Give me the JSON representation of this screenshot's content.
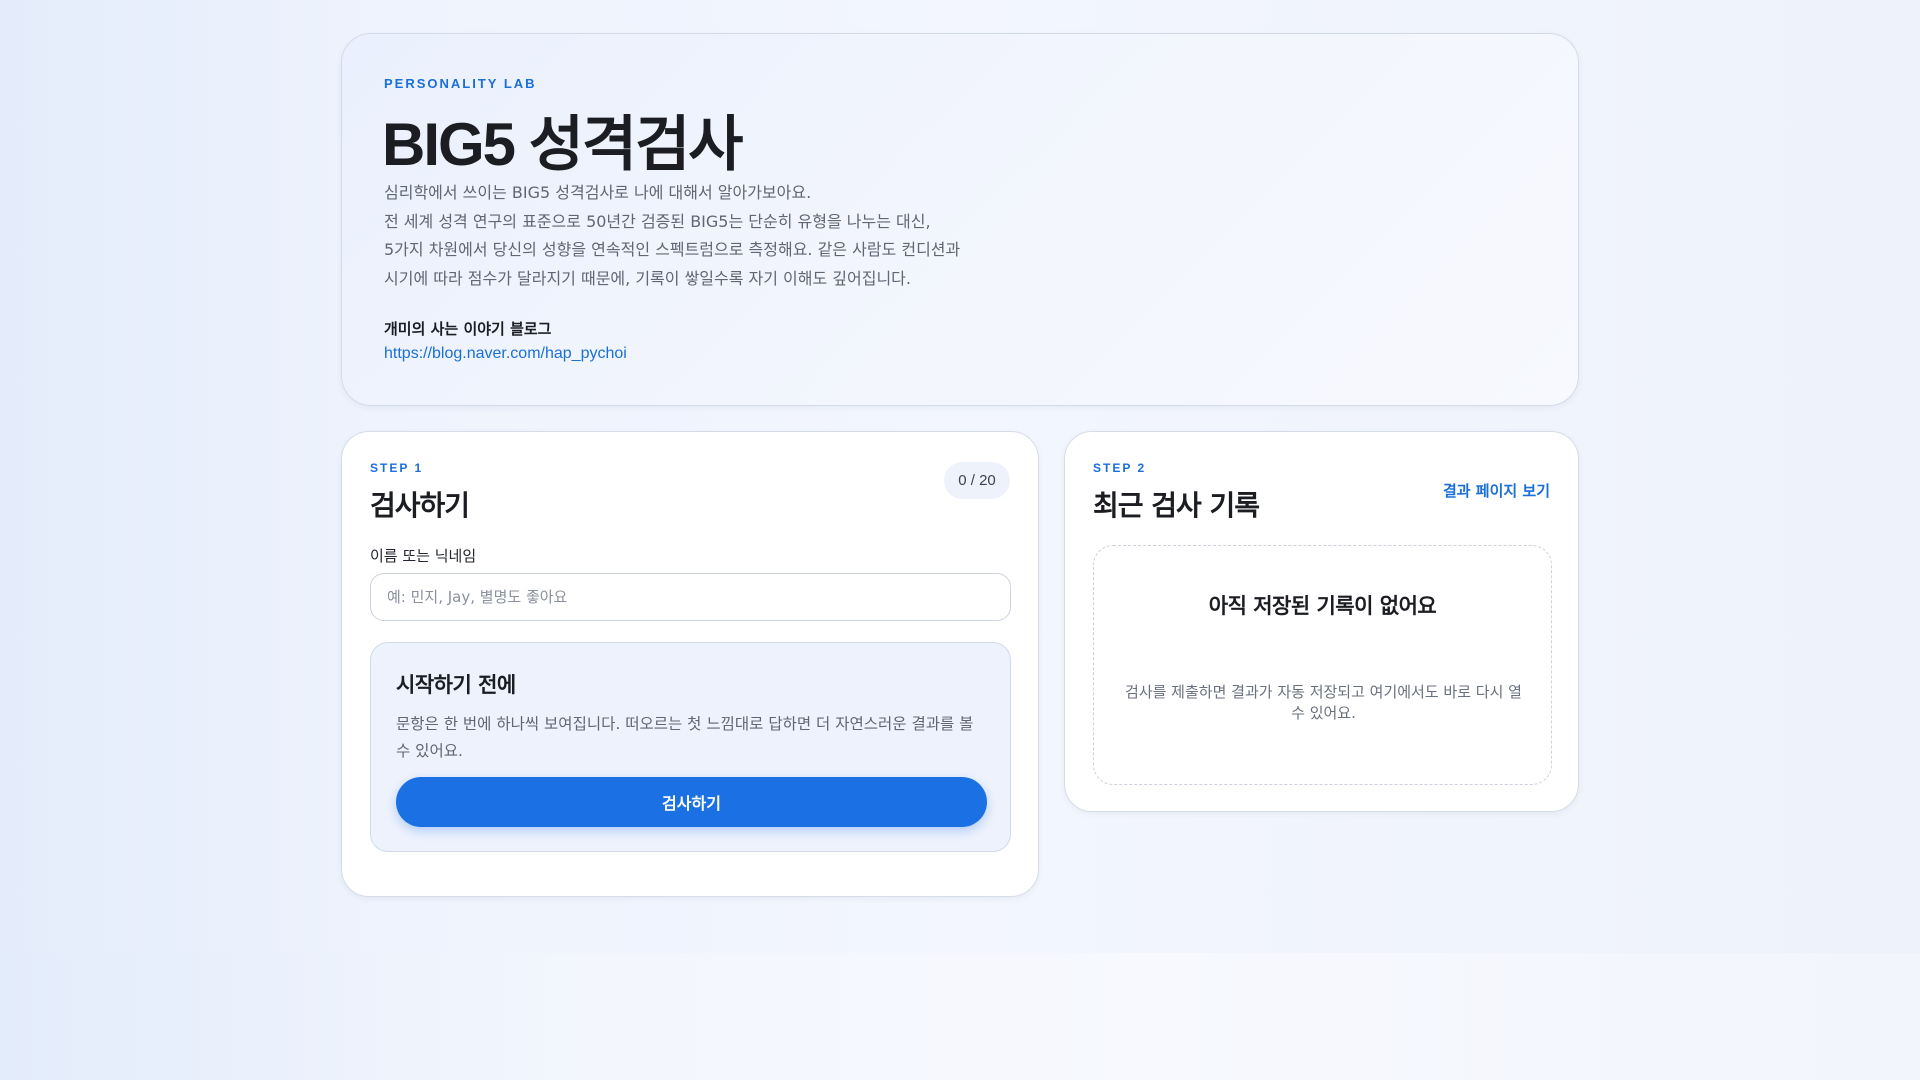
{
  "hero": {
    "eyebrow": "PERSONALITY LAB",
    "title": "BIG5 성격검사",
    "description": [
      "심리학에서 쓰이는 BIG5 성격검사로 나에 대해서 알아가보아요.",
      "전 세계 성격 연구의 표준으로 50년간 검증된 BIG5는 단순히 유형을 나누는 대신,",
      "5가지 차원에서 당신의 성향을 연속적인 스펙트럼으로 측정해요. 같은 사람도 컨디션과",
      "시기에 따라 점수가 달라지기 때문에, 기록이 쌓일수록 자기 이해도 깊어집니다."
    ],
    "blog_label": "개미의 사는 이야기 블로그",
    "blog_url": "https://blog.naver.com/hap_pychoi"
  },
  "step1": {
    "eyebrow": "STEP 1",
    "title": "검사하기",
    "counter": "0 / 20",
    "name_label": "이름 또는 닉네임",
    "name_value": "",
    "name_placeholder": "예: 민지, Jay, 별명도 좋아요",
    "prep_title": "시작하기 전에",
    "prep_text": "문항은 한 번에 하나씩 보여집니다. 떠오르는 첫 느낌대로 답하면 더 자연스러운 결과를 볼 수 있어요.",
    "start_label": "검사하기"
  },
  "step2": {
    "eyebrow": "STEP 2",
    "title": "최근 검사 기록",
    "results_link": "결과 페이지 보기",
    "empty_title": "아직 저장된 기록이 없어요",
    "empty_text": "검사를 제출하면 결과가 자동 저장되고 여기에서도 바로 다시 열 수 있어요."
  },
  "colors": {
    "accent": "#1b71e4",
    "link": "#1a6fd9"
  }
}
